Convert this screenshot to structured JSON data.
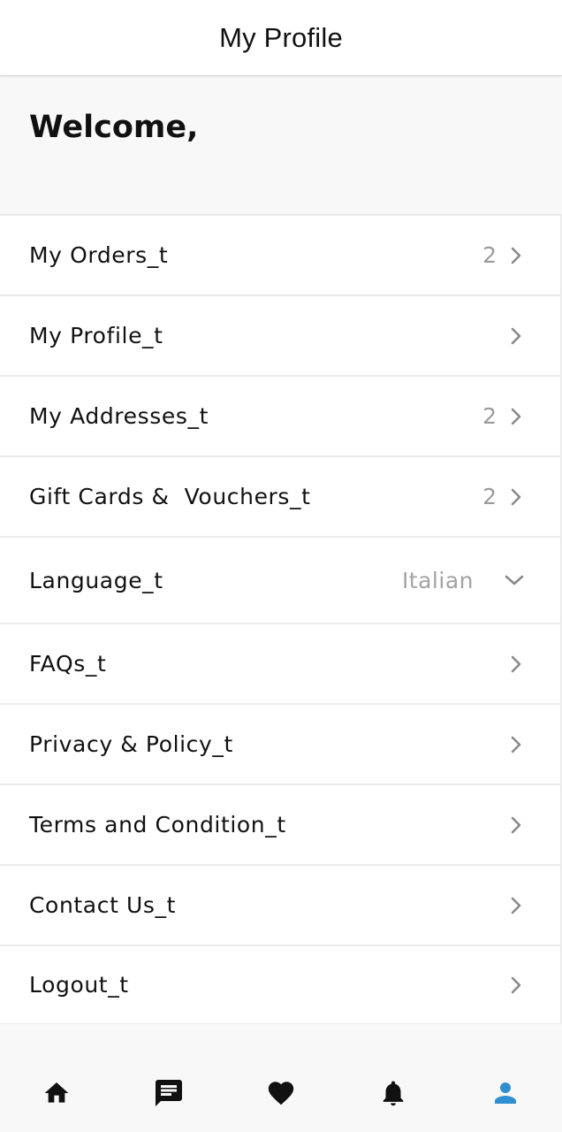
{
  "header": {
    "title": "My Profile"
  },
  "welcome": {
    "text": "Welcome,"
  },
  "menu": {
    "items": [
      {
        "label": "My Orders_t",
        "count": "2",
        "icon": "chevron-right-icon"
      },
      {
        "label": "My Profile_t",
        "count": "",
        "icon": "chevron-right-icon"
      },
      {
        "label": "My Addresses_t",
        "count": "2",
        "icon": "chevron-right-icon"
      },
      {
        "label": "Gift Cards &  Vouchers_t",
        "count": "2",
        "icon": "chevron-right-icon"
      },
      {
        "label": "Language_t",
        "value": "Italian",
        "icon": "chevron-down-icon"
      },
      {
        "label": "FAQs_t",
        "count": "",
        "icon": "chevron-right-icon"
      },
      {
        "label": "Privacy & Policy_t",
        "count": "",
        "icon": "chevron-right-icon"
      },
      {
        "label": "Terms and Condition_t",
        "count": "",
        "icon": "chevron-right-icon"
      },
      {
        "label": "Contact Us_t",
        "count": "",
        "icon": "chevron-right-icon"
      },
      {
        "label": "Logout_t",
        "count": "",
        "icon": "chevron-right-icon"
      }
    ]
  },
  "bottom_nav": {
    "items": [
      {
        "icon": "home-icon",
        "active": false
      },
      {
        "icon": "chat-icon",
        "active": false
      },
      {
        "icon": "heart-icon",
        "active": false
      },
      {
        "icon": "bell-icon",
        "active": false
      },
      {
        "icon": "person-icon",
        "active": true
      }
    ]
  },
  "colors": {
    "accent": "#2f8fd0",
    "text": "#111111",
    "muted": "#9a9a9a",
    "chevron": "#8a8a8a",
    "background_gray": "#f8f8f8",
    "divider": "#ececec"
  }
}
